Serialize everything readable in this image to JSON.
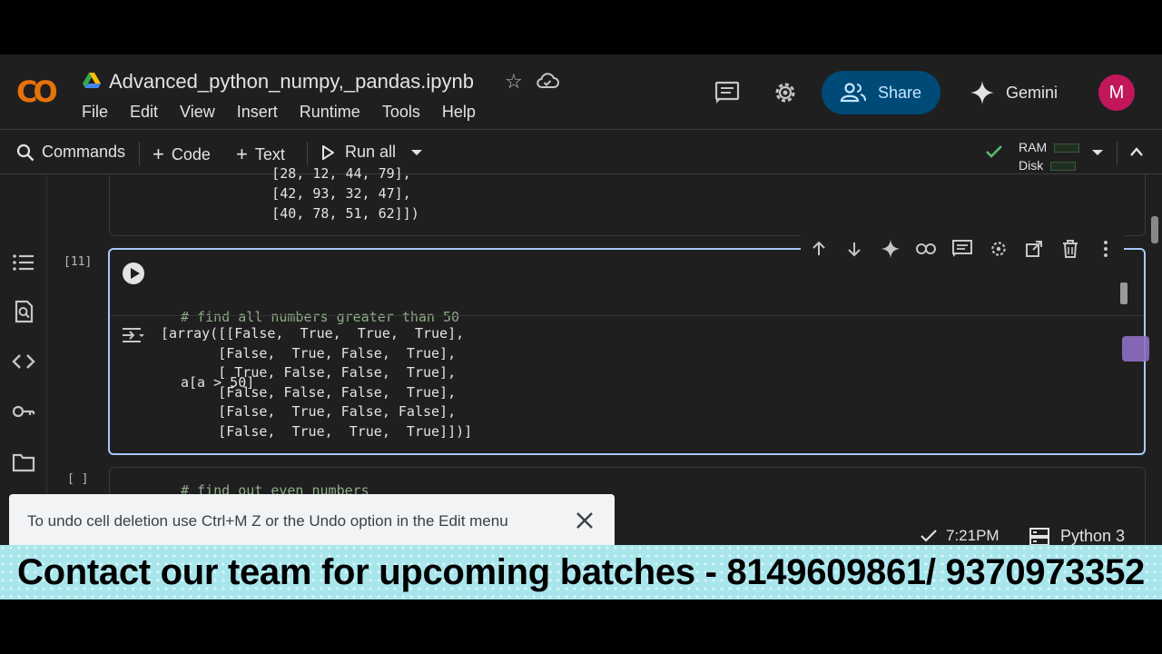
{
  "header": {
    "logo_text": "CO",
    "notebook_title": "Advanced_python_numpy,_pandas.ipynb",
    "menu": [
      "File",
      "Edit",
      "View",
      "Insert",
      "Runtime",
      "Tools",
      "Help"
    ],
    "share_label": "Share",
    "gemini_label": "Gemini",
    "avatar_initial": "M"
  },
  "toolbar": {
    "commands_label": "Commands",
    "code_label": "Code",
    "text_label": "Text",
    "run_all_label": "Run all",
    "ram_label": "RAM",
    "disk_label": "Disk"
  },
  "cells": {
    "previous_output": "      [28, 12, 44, 79],\n      [42, 93, 32, 47],\n      [40, 78, 51, 62]])",
    "active": {
      "execution_count": "[11]",
      "comment": "# find all numbers greater than 50",
      "code": "a[a > 50]",
      "output": "[array([[False,  True,  True,  True],\n       [False,  True, False,  True],\n       [ True, False, False,  True],\n       [False, False, False,  True],\n       [False,  True, False, False],\n       [False,  True,  True,  True]])]"
    },
    "next": {
      "execution_count": "[ ]",
      "comment": "# find out even numbers"
    }
  },
  "snackbar": {
    "message": "To undo cell deletion use Ctrl+M Z or the Undo option in the Edit menu"
  },
  "status": {
    "time": "7:21PM",
    "kernel": "Python 3"
  },
  "banner": {
    "text": "Contact our team for upcoming batches - 8149609861/ 9370973352"
  },
  "colors": {
    "accent": "#a8c7fa",
    "share_bg": "#004a77",
    "avatar_bg": "#c2185b",
    "banner_bg": "#a8e6ec"
  }
}
